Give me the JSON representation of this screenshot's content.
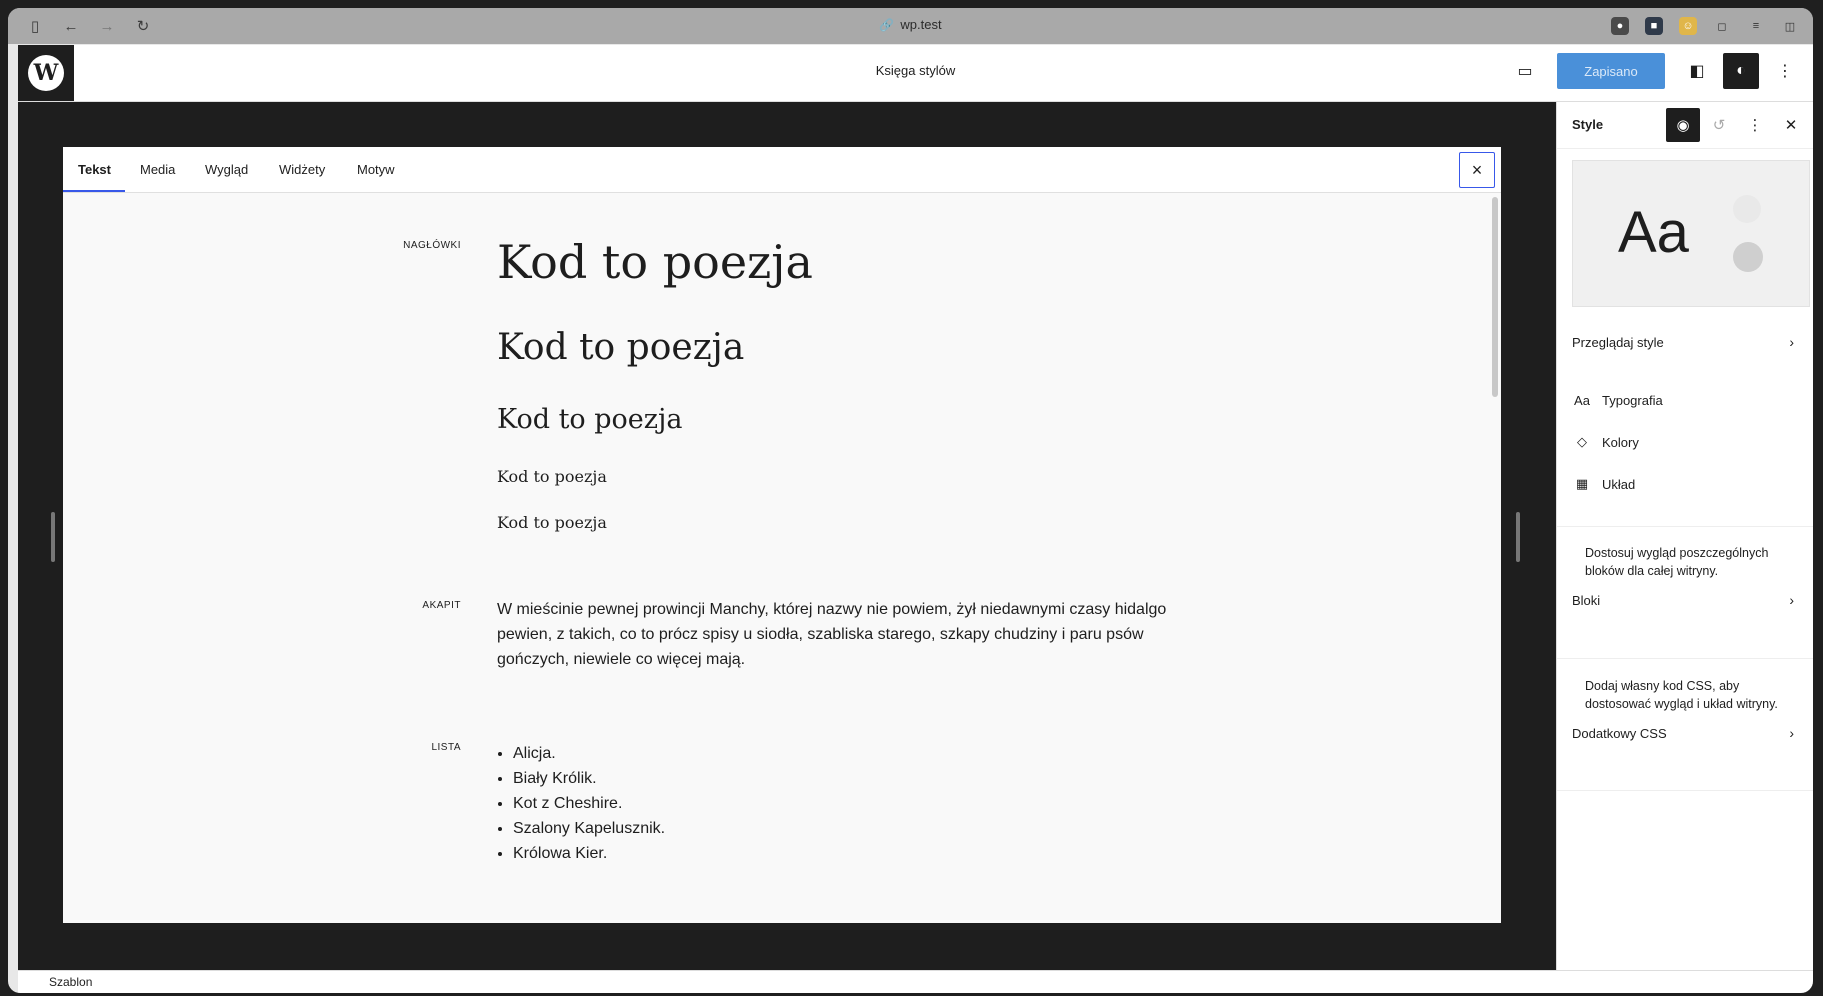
{
  "browser": {
    "url": "wp.test"
  },
  "topbar": {
    "title": "Księga stylów",
    "save_label": "Zapisano"
  },
  "stylebook": {
    "tabs": [
      {
        "label": "Tekst"
      },
      {
        "label": "Media"
      },
      {
        "label": "Wygląd"
      },
      {
        "label": "Widżety"
      },
      {
        "label": "Motyw"
      }
    ],
    "close_label": "×",
    "sections": {
      "headings_label": "NAGŁÓWKI",
      "paragraph_label": "AKAPIT",
      "list_label": "LISTA"
    },
    "headings": [
      "Kod to poezja",
      "Kod to poezja",
      "Kod to poezja",
      "Kod to poezja",
      "Kod to poezja"
    ],
    "paragraph": "W mieścinie pewnej prowincji Manchy, której nazwy nie powiem, żył niedawnymi czasy hidalgo pewien, z takich, co to prócz spisy u siodła, szabliska starego, szkapy chudziny i paru psów gończych, niewiele co więcej mają.",
    "list": [
      "Alicja.",
      "Biały Królik.",
      "Kot z Cheshire.",
      "Szalony Kapelusznik.",
      "Królowa Kier."
    ]
  },
  "sidebar": {
    "title": "Style",
    "preview_text": "Aa",
    "browse_label": "Przeglądaj style",
    "items": [
      {
        "label": "Typografia",
        "icon_text": "Aa"
      },
      {
        "label": "Kolory"
      },
      {
        "label": "Układ"
      }
    ],
    "blocks_desc": "Dostosuj wygląd poszczególnych bloków dla całej witryny.",
    "blocks_label": "Bloki",
    "css_desc": "Dodaj własny kod CSS, aby dostosować wygląd i układ witryny.",
    "css_label": "Dodatkowy CSS"
  },
  "footer": {
    "label": "Szablon"
  }
}
